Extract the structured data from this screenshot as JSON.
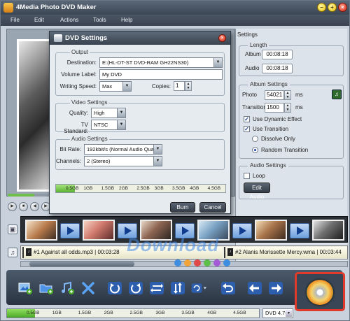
{
  "app": {
    "title": "4Media Photo DVD Maker"
  },
  "menu": [
    "File",
    "Edit",
    "Actions",
    "Tools",
    "Help"
  ],
  "settings_panel": {
    "header": "Settings",
    "length": {
      "title": "Length",
      "album_label": "Album",
      "album_value": "00:08:18",
      "audio_label": "Audio",
      "audio_value": "00:08:18"
    },
    "album_settings": {
      "title": "Album Settings",
      "photo_label": "Photo",
      "photo_value": "54021",
      "photo_unit": "ms",
      "transition_label": "Transition",
      "transition_value": "1500",
      "transition_unit": "ms",
      "use_dynamic_effect": "Use Dynamic Effect",
      "use_transition": "Use Transition",
      "dissolve_only": "Dissolve Only",
      "random_transition": "Random Transition"
    },
    "audio_settings": {
      "title": "Audio Settings",
      "loop_label": "Loop",
      "edit_audio": "Edit Audio"
    }
  },
  "dialog": {
    "title": "DVD Settings",
    "output": {
      "title": "Output",
      "destination_label": "Destination:",
      "destination_value": "E:(HL-DT-ST DVD-RAM GH22NS30)",
      "volume_label": "Volume Label:",
      "volume_value": "My DVD",
      "writing_speed_label": "Writing Speed:",
      "writing_speed_value": "Max",
      "copies_label": "Copies:",
      "copies_value": "1"
    },
    "video": {
      "title": "Video Settings",
      "quality_label": "Quality:",
      "quality_value": "High",
      "tv_label": "TV Standard:",
      "tv_value": "NTSC"
    },
    "audio": {
      "title": "Audio Settings",
      "bitrate_label": "Bit Rate:",
      "bitrate_value": "192kbit/s (Normal Audio Quality",
      "channels_label": "Channels:",
      "channels_value": "2 (Stereo)"
    },
    "capacity_ticks": [
      "0.5GB",
      "1GB",
      "1.5GB",
      "2GB",
      "2.5GB",
      "3GB",
      "3.5GB",
      "4GB",
      "4.5GB"
    ],
    "capacity_fraction": 0.11,
    "burn_button": "Burn",
    "cancel_button": "Cancel"
  },
  "timeline": {
    "audio_tracks": [
      {
        "label": "#1 Against all odds.mp3 | 00:03:28"
      },
      {
        "label": "#2 Alanis Morissette Mercy.wma | 00:03:44"
      }
    ]
  },
  "bottom": {
    "capacity_ticks": [
      "0.5GB",
      "1GB",
      "1.5GB",
      "2GB",
      "2.5GB",
      "3GB",
      "3.5GB",
      "4GB",
      "4.5GB"
    ],
    "capacity_fraction": 0.11,
    "disc_type": "DVD 4.7G"
  },
  "watermark": "Download",
  "colors": {
    "accent_red": "#e23a2a",
    "capacity_green": "#4da92a"
  }
}
